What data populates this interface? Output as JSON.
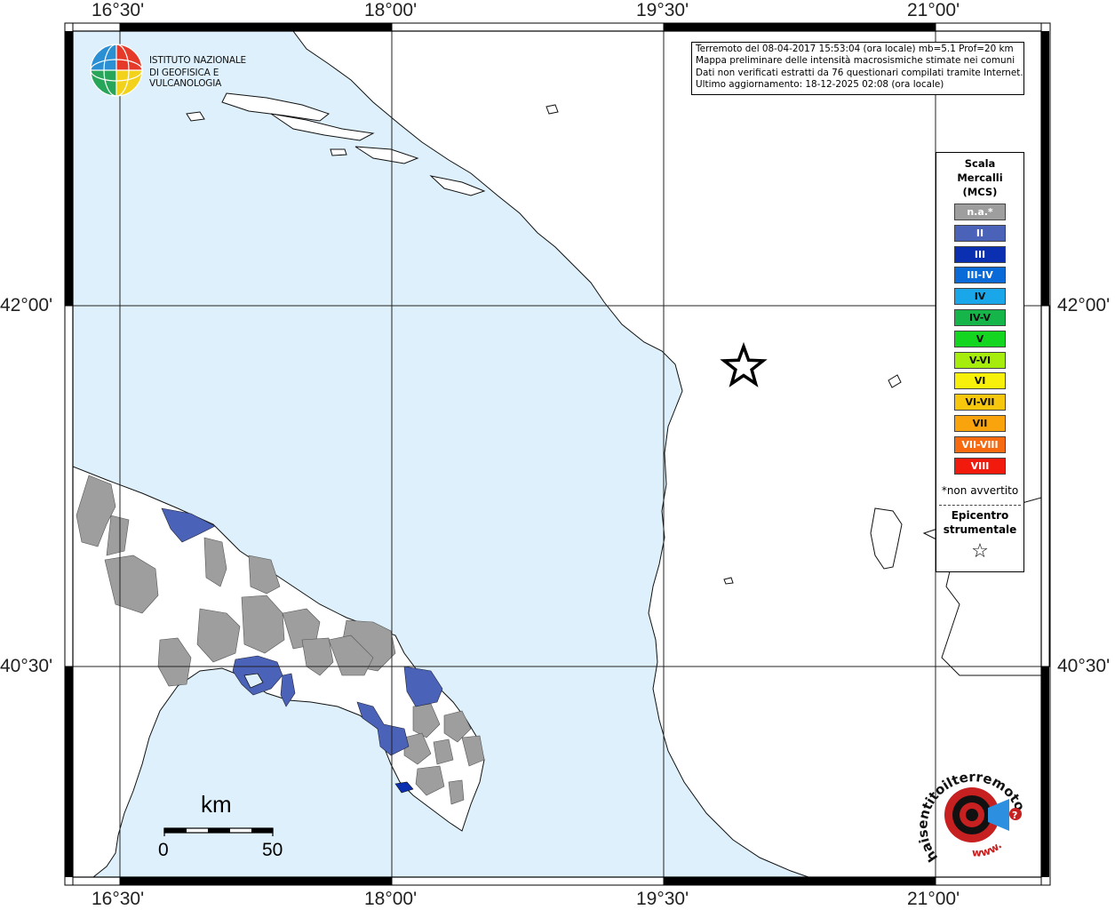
{
  "map": {
    "sea_color": "#ddf0fb",
    "land_color": "#ffffff",
    "frame_color": "#000000",
    "intensity_colors": {
      "na": "#9e9e9e",
      "II": "#4a63b8",
      "III": "#0a2fb0"
    }
  },
  "axes": {
    "top_labels": [
      "16°30'",
      "18°00'",
      "19°30'",
      "21°00'"
    ],
    "bottom_labels": [
      "16°30'",
      "18°00'",
      "19°30'",
      "21°00'"
    ],
    "left_labels": [
      "42°00'",
      "40°30'"
    ],
    "right_labels": [
      "42°00'",
      "40°30'"
    ]
  },
  "info": {
    "line1": "Terremoto del 08-04-2017 15:53:04 (ora locale) mb=5.1 Prof=20 km",
    "line2": "Mappa preliminare delle intensità macrosismiche stimate nei comuni",
    "line3": "Dati non verificati estratti da 76 questionari compilati tramite Internet.",
    "line4": "Ultimo aggiornamento: 18-12-2025 02:08 (ora locale)"
  },
  "logo": {
    "line1": "ISTITUTO NAZIONALE",
    "line2": "DI GEOFISICA E VULCANOLOGIA"
  },
  "legend": {
    "title1": "Scala",
    "title2": "Mercalli",
    "title3": "(MCS)",
    "items": [
      {
        "label": "n.a.*",
        "color": "#9e9e9e"
      },
      {
        "label": "II",
        "color": "#4a63b8"
      },
      {
        "label": "III",
        "color": "#0a2fb0"
      },
      {
        "label": "III-IV",
        "color": "#0a6ad8"
      },
      {
        "label": "IV",
        "color": "#1aa7ea"
      },
      {
        "label": "IV-V",
        "color": "#15b54a"
      },
      {
        "label": "V",
        "color": "#14d51f"
      },
      {
        "label": "V-VI",
        "color": "#a6ec0c"
      },
      {
        "label": "VI",
        "color": "#f7f00a"
      },
      {
        "label": "VI-VII",
        "color": "#f7c70d"
      },
      {
        "label": "VII",
        "color": "#f9a40d"
      },
      {
        "label": "VII-VIII",
        "color": "#f76a0f"
      },
      {
        "label": "VIII",
        "color": "#f21a0d"
      }
    ],
    "note": "*non avvertito",
    "epicenter_line1": "Epicentro",
    "epicenter_line2": "strumentale",
    "epicenter_symbol": "☆"
  },
  "scalebar": {
    "unit": "km",
    "min_label": "0",
    "max_label": "50"
  },
  "hst_logo": {
    "text_main": "haisentitoilterremoto.it",
    "text_www": "www."
  }
}
